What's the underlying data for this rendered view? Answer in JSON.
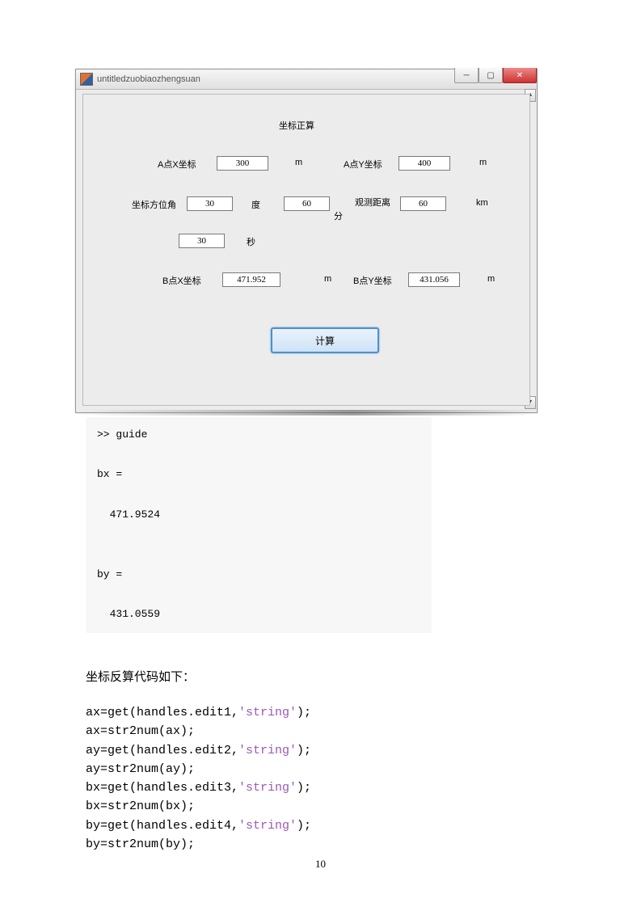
{
  "window": {
    "title": "untitledzuobiaozhengsuan",
    "heading": "坐标正算",
    "labels": {
      "ax": "A点X坐标",
      "ay": "A点Y坐标",
      "azimuth": "坐标方位角",
      "degree": "度",
      "minute": "分",
      "second": "秒",
      "distance": "观测距离",
      "bx": "B点X坐标",
      "by": "B点Y坐标",
      "m": "m",
      "km": "km"
    },
    "values": {
      "ax": "300",
      "ay": "400",
      "deg": "30",
      "min": "60",
      "sec": "30",
      "dist": "60",
      "bx": "471.952",
      "by": "431.056"
    },
    "button": "计算"
  },
  "cmd": {
    "text": ">> guide\n\nbx =\n\n  471.9524\n\n\nby =\n\n  431.0559\n"
  },
  "body": {
    "heading": "坐标反算代码如下："
  },
  "code": {
    "l1a": "ax=get(handles.edit1,",
    "l1b": "'string'",
    "l1c": ");",
    "l2": "ax=str2num(ax);",
    "l3a": "ay=get(handles.edit2,",
    "l3b": "'string'",
    "l3c": ");",
    "l4": "ay=str2num(ay);",
    "l5a": "bx=get(handles.edit3,",
    "l5b": "'string'",
    "l5c": ");",
    "l6": "bx=str2num(bx);",
    "l7a": "by=get(handles.edit4,",
    "l7b": "'string'",
    "l7c": ");",
    "l8": "by=str2num(by);"
  },
  "page_number": "10"
}
